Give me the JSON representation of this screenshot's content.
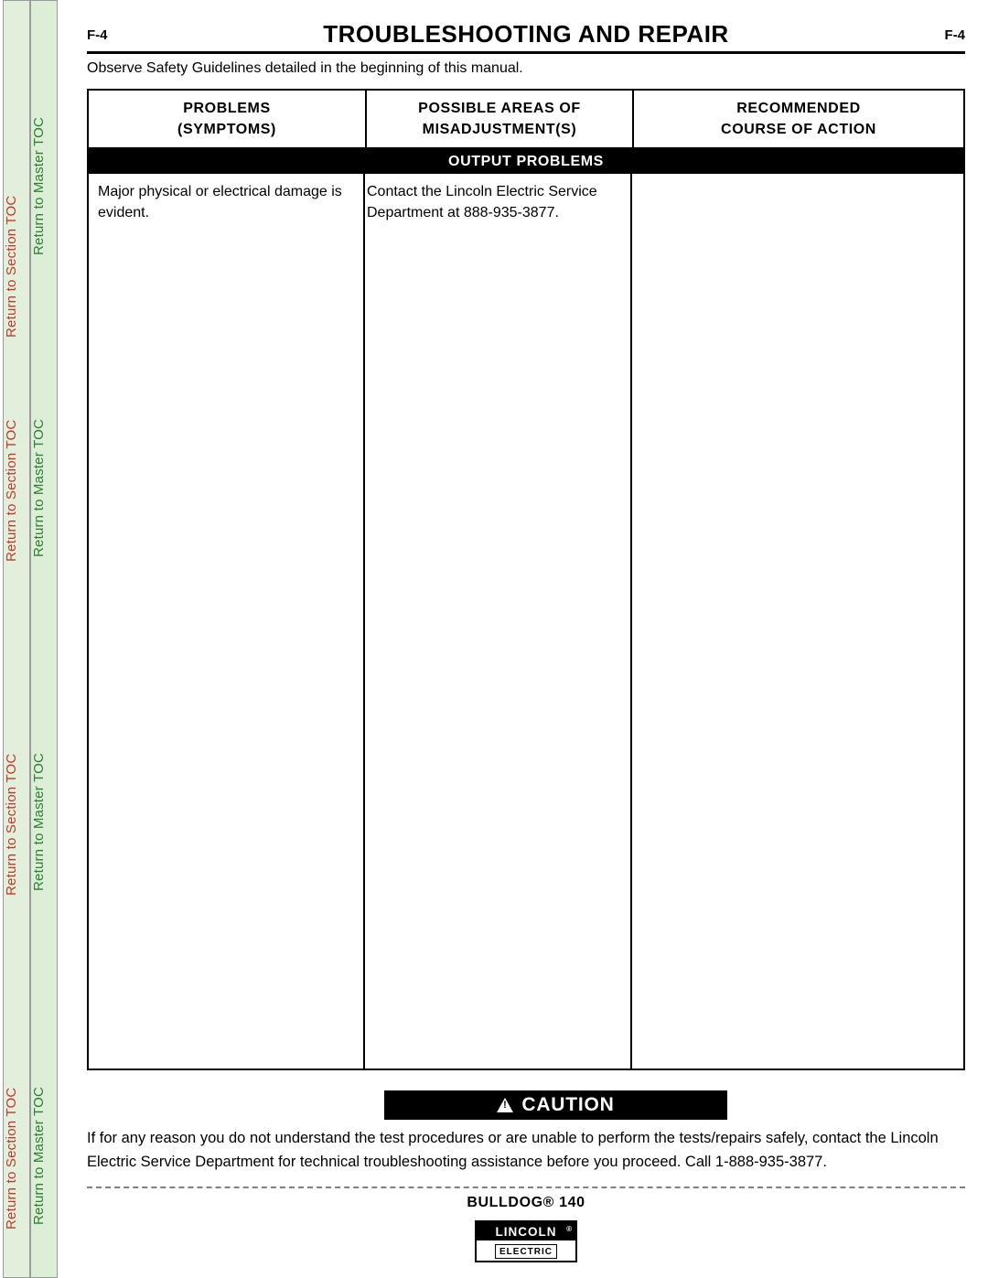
{
  "rails": {
    "section_toc": "Return to Section TOC",
    "master_toc": "Return to Master TOC",
    "section_color": "#c0392b",
    "master_color": "#2e7d32"
  },
  "header": {
    "title": "TROUBLESHOOTING AND REPAIR",
    "page_left": "F-4",
    "page_right": "F-4"
  },
  "observe_note": "Observe Safety Guidelines detailed in the beginning of this manual.",
  "table": {
    "headers": [
      {
        "line1": "PROBLEMS",
        "line2": "(SYMPTOMS)"
      },
      {
        "line1": "POSSIBLE AREAS OF",
        "line2": "MISADJUSTMENT(S)"
      },
      {
        "line1": "RECOMMENDED",
        "line2": "COURSE OF ACTION"
      }
    ],
    "band_label": "OUTPUT PROBLEMS",
    "rows": [
      {
        "problem": "Major physical or electrical damage is evident.",
        "possible_areas": "Contact the Lincoln Electric Service Department at 888-935-3877.",
        "recommended": ""
      }
    ]
  },
  "caution": {
    "icon": "warning-triangle-icon",
    "label": "CAUTION",
    "body": "If for any reason you do not understand the test procedures or are unable to perform the tests/repairs safely, contact the Lincoln Electric Service Department for technical troubleshooting assistance before you proceed. Call 1-888-935-3877."
  },
  "footer": {
    "model": "BULLDOG® 140",
    "logo_top": "LINCOLN",
    "logo_reg": "®",
    "logo_bottom": "ELECTRIC"
  }
}
